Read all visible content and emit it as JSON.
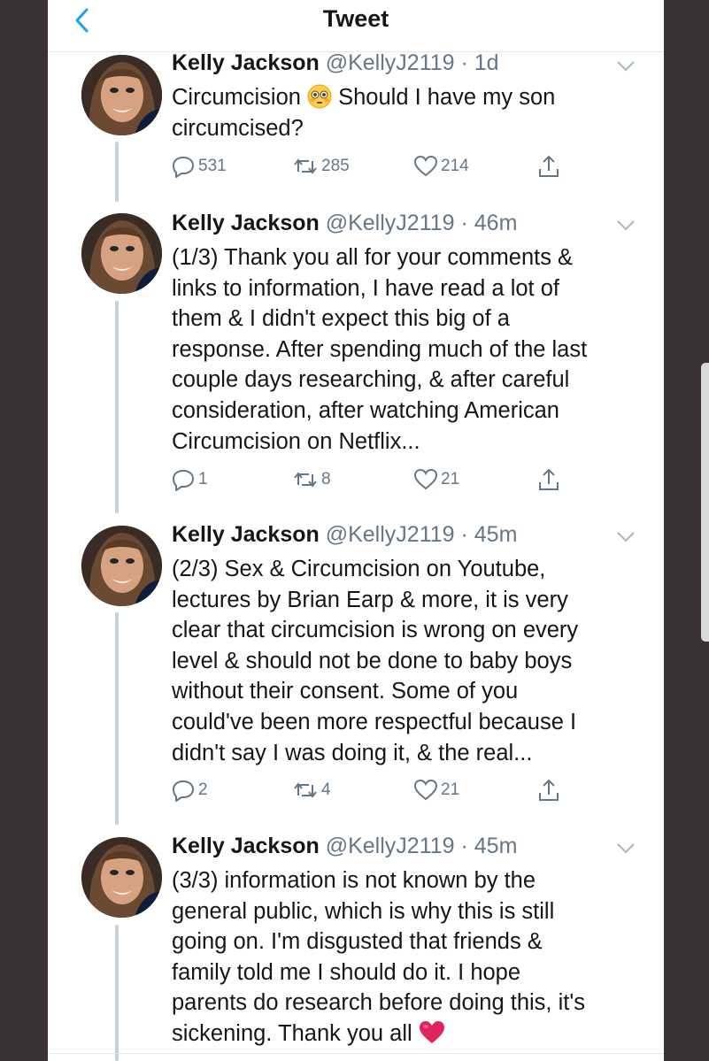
{
  "header": {
    "title": "Tweet"
  },
  "colors": {
    "accent": "#1da1f2",
    "text": "#14171a",
    "muted": "#657786",
    "heart": "#e0245e"
  },
  "tweets": [
    {
      "name": "Kelly Jackson",
      "handle": "@KellyJ2119",
      "time": "· 1d",
      "text_before_emoji": "Circumcision ",
      "emoji": "flushed-face-emoji",
      "text_after_emoji": " Should I have my son circumcised?",
      "replies": "531",
      "retweets": "285",
      "likes": "214"
    },
    {
      "name": "Kelly Jackson",
      "handle": "@KellyJ2119",
      "time": "· 46m",
      "text": "(1/3) Thank you all for your comments &\nlinks to information, I have read a lot of\nthem & I didn't expect this big of a\nresponse. After spending much of the last\ncouple days researching, & after careful\nconsideration, after watching American\nCircumcision on Netflix...",
      "replies": "1",
      "retweets": "8",
      "likes": "21"
    },
    {
      "name": "Kelly Jackson",
      "handle": "@KellyJ2119",
      "time": "· 45m",
      "text": "(2/3) Sex & Circumcision on Youtube,\nlectures by Brian Earp & more, it is very\nclear that circumcision is wrong on every\nlevel & should not be done to baby boys\nwithout their consent. Some of you\ncould've been more respectful because I\ndidn't say I was doing it, & the real...",
      "replies": "2",
      "retweets": "4",
      "likes": "21"
    },
    {
      "name": "Kelly Jackson",
      "handle": "@KellyJ2119",
      "time": "· 45m",
      "text": "(3/3) information is not known by the\ngeneral public, which is why this is still\ngoing on. I'm disgusted that friends &\nfamily told me I should do it.  I hope\nparents do research before doing this, it's\nsickening. Thank you all ",
      "emoji": "red-heart-emoji"
    }
  ]
}
